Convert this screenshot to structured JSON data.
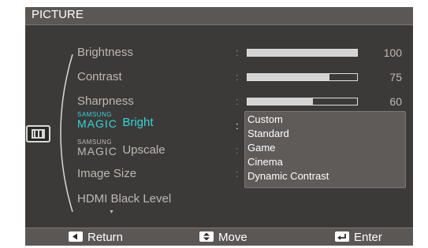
{
  "window": {
    "title": "PICTURE"
  },
  "menu": {
    "brightness": {
      "label": "Brightness",
      "value": "100",
      "level": 1.0
    },
    "contrast": {
      "label": "Contrast",
      "value": "75",
      "level": 0.75
    },
    "sharpness": {
      "label": "Sharpness",
      "value": "60",
      "level": 0.6
    },
    "magic_bright": {
      "brand_top": "SAMSUNG",
      "brand_bottom": "MAGIC",
      "word": "Bright"
    },
    "magic_upscale": {
      "brand_top": "SAMSUNG",
      "brand_bottom": "MAGIC",
      "word": "Upscale"
    },
    "image_size": {
      "label": "Image Size"
    },
    "hdmi_black_level": {
      "label": "HDMI Black Level"
    },
    "separator": ":",
    "more_indicator": "▼"
  },
  "dropdown": {
    "options": [
      "Custom",
      "Standard",
      "Game",
      "Cinema",
      "Dynamic Contrast"
    ],
    "selected": "Custom"
  },
  "footer": {
    "return_label": "Return",
    "move_label": "Move",
    "enter_label": "Enter"
  },
  "colors": {
    "highlight": "#2fd0d4",
    "active_text": "#2fd7dc",
    "panel": "#3c3a39",
    "bar_header": "#5b5755"
  },
  "icons": {
    "menu": "picture-mode-icon",
    "return": "return-key-icon",
    "move": "updown-key-icon",
    "enter": "enter-key-icon"
  }
}
